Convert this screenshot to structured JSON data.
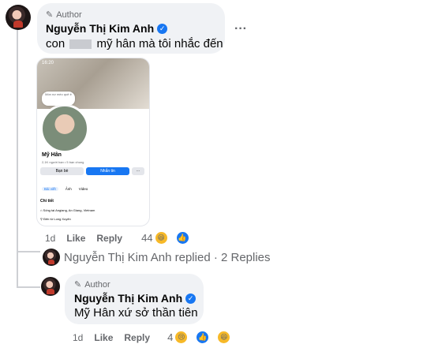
{
  "comment1": {
    "author_tag": "Author",
    "name": "Nguyễn Thị Kim Anh",
    "text_prefix": "con",
    "text_suffix": "mỹ hân mà tôi nhắc đến",
    "more": "···",
    "time": "1d",
    "like": "Like",
    "reply": "Reply",
    "reactions_count": "44"
  },
  "embedded_screenshot": {
    "status_time": "16:20",
    "note": "Món nợ mèo quê ê",
    "profile_name": "Mỹ Hân",
    "profile_stats": "2,1K người bạn • 5 bạn chung",
    "friends_button": "Bạn bè",
    "message_button": "Nhắn tin",
    "more_button": "···",
    "tabs": [
      "Bài viết",
      "Ảnh",
      "Video"
    ],
    "details_title": "Chi tiết",
    "detail_line_1": "Sống tại Angiang, An Giang, Vietnam",
    "detail_line_2": "Đến từ Long Xuyên"
  },
  "replies_summary": {
    "text": "Nguyễn Thị Kim Anh replied · 2 Replies"
  },
  "comment2": {
    "author_tag": "Author",
    "name": "Nguyễn Thị Kim Anh",
    "text": "Mỹ Hân xứ sở thần tiên",
    "time": "1d",
    "like": "Like",
    "reply": "Reply",
    "reactions_count": "4"
  },
  "colors": {
    "bubble": "#f0f2f5",
    "verified": "#1877f2",
    "secondary_text": "#65676b"
  }
}
